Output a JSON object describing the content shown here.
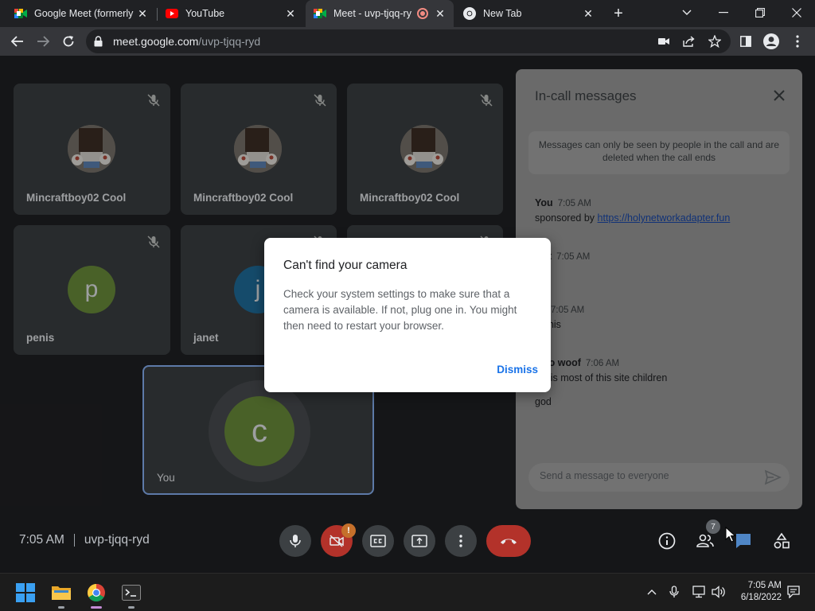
{
  "browser": {
    "tabs": [
      {
        "title": "Google Meet (formerly",
        "favicon": "meet-icon",
        "active": false
      },
      {
        "title": "YouTube",
        "favicon": "youtube-icon",
        "active": false
      },
      {
        "title": "Meet - uvp-tjqq-ry",
        "favicon": "meet-icon",
        "active": true,
        "recording": true
      },
      {
        "title": "New Tab",
        "favicon": "chrome-icon",
        "active": false
      }
    ],
    "address": {
      "host": "meet.google.com",
      "path": "/uvp-tjqq-ryd"
    }
  },
  "meet": {
    "tiles": [
      {
        "name": "Mincraftboy02 Cool",
        "avatar": "photo",
        "muted": true
      },
      {
        "name": "Mincraftboy02 Cool",
        "avatar": "photo",
        "muted": true
      },
      {
        "name": "Mincraftboy02 Cool",
        "avatar": "photo",
        "muted": true
      },
      {
        "name": "penis",
        "letter": "p",
        "color": "#6c8f3c",
        "muted": true
      },
      {
        "name": "janet",
        "letter": "j",
        "color": "#1f6f9e",
        "muted": true
      },
      {
        "name": "",
        "muted": true
      }
    ],
    "self_tile": {
      "name": "You",
      "letter": "c",
      "color": "#6c8f3c",
      "ring_color": "#4a4d51"
    },
    "call_time": "7:05 AM",
    "meeting_code": "uvp-tjqq-ryd",
    "camera_warning": "!",
    "participant_count": "7"
  },
  "panel": {
    "title": "In-call messages",
    "notice": "Messages can only be seen by people in the call and are deleted when the call ends",
    "messages": [
      {
        "sender": "You",
        "time": "7:05 AM",
        "prefix": "sponsored by ",
        "link": "https://holynetworkadapter.fun"
      },
      {
        "sender": "et",
        "time": "7:05 AM",
        "body": ""
      },
      {
        "sender": "",
        "time": "7:05 AM",
        "body": "enis"
      },
      {
        "sender": "go woof",
        "time": "7:06 AM",
        "body": "y is most of this site children",
        "body2": "god"
      }
    ],
    "input_placeholder": "Send a message to everyone"
  },
  "dialog": {
    "title": "Can't find your camera",
    "body": "Check your system settings to make sure that a camera is available. If not, plug one in. You might then need to restart your browser.",
    "button": "Dismiss"
  },
  "taskbar": {
    "time": "7:05 AM",
    "date": "6/18/2022"
  },
  "colors": {
    "accent_blue": "#1a73e8",
    "leave_red": "#b3322a",
    "self_border": "#8ab4f8"
  }
}
